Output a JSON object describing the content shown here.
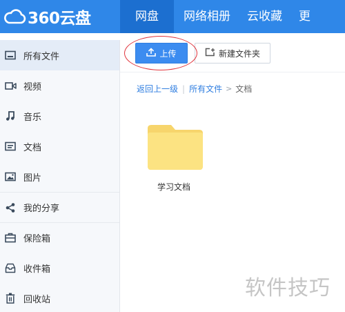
{
  "app": {
    "logo_text": "360云盘"
  },
  "nav": {
    "items": [
      {
        "label": "网盘",
        "active": true
      },
      {
        "label": "网络相册"
      },
      {
        "label": "云收藏"
      },
      {
        "label": "更"
      }
    ]
  },
  "sidebar": {
    "items": [
      {
        "label": "所有文件",
        "icon": "all-files-icon",
        "active": true
      },
      {
        "label": "视频",
        "icon": "video-icon"
      },
      {
        "label": "音乐",
        "icon": "music-icon"
      },
      {
        "label": "文档",
        "icon": "document-icon"
      },
      {
        "label": "图片",
        "icon": "image-icon"
      },
      {
        "label": "我的分享",
        "icon": "share-icon"
      },
      {
        "label": "保险箱",
        "icon": "safe-box-icon"
      },
      {
        "label": "收件箱",
        "icon": "inbox-icon"
      },
      {
        "label": "回收站",
        "icon": "trash-icon"
      }
    ]
  },
  "toolbar": {
    "upload_label": "上传",
    "new_folder_label": "新建文件夹"
  },
  "breadcrumb": {
    "back": "返回上一级",
    "root": "所有文件",
    "current": "文档"
  },
  "files": [
    {
      "name": "学习文档",
      "type": "folder"
    }
  ],
  "watermark": "软件技巧",
  "colors": {
    "topbar": "#2f87e8",
    "nav_active": "#1c6fd0",
    "upload_button": "#3c8cf0",
    "folder": "#fce382",
    "highlight": "#e0333b"
  }
}
